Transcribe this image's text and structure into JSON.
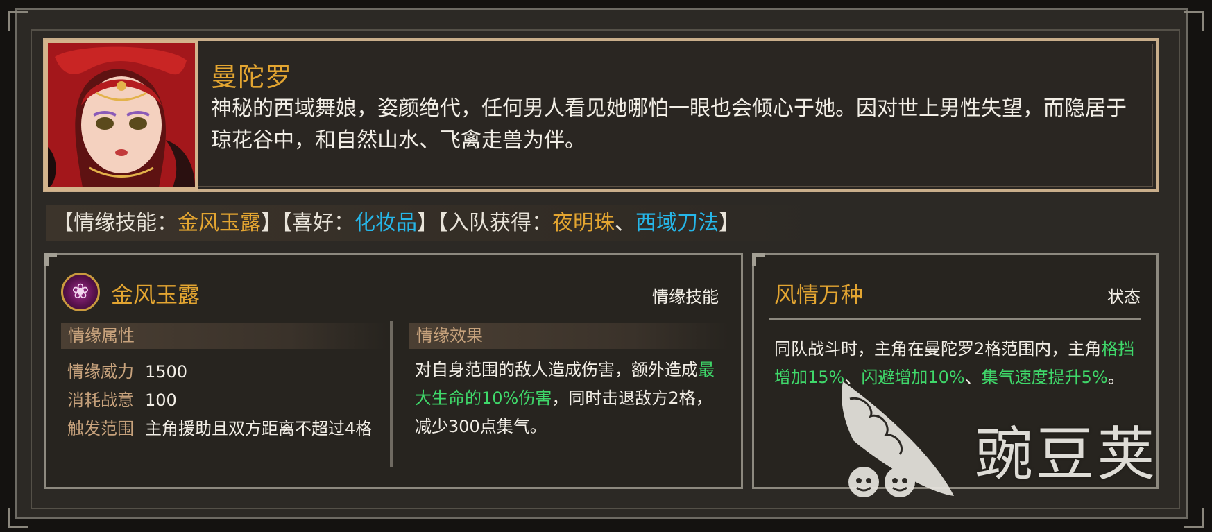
{
  "character": {
    "name": "曼陀罗",
    "description": "神秘的西域舞娘，姿颜绝代，任何男人看见她哪怕一眼也会倾心于她。因对世上男性失望，而隐居于琼花谷中，和自然山水、飞禽走兽为伴。"
  },
  "info_strip": {
    "skill_open": "【情缘技能：",
    "skill_value": "金风玉露",
    "skill_close": "】",
    "hobby_open": "【喜好：",
    "hobby_value": "化妆品",
    "hobby_close": "】",
    "join_open": "【入队获得：",
    "join_item1": "夜明珠",
    "join_sep": "、",
    "join_item2": "西域刀法",
    "join_close": "】"
  },
  "skill_panel": {
    "icon": "lotus-emblem-icon",
    "name": "金风玉露",
    "tag": "情缘技能",
    "attr_header": "情缘属性",
    "attrs": [
      {
        "label": "情缘威力",
        "value": "1500"
      },
      {
        "label": "消耗战意",
        "value": "100"
      },
      {
        "label": "触发范围",
        "value": "主角援助且双方距离不超过4格"
      }
    ],
    "effect_header": "情缘效果",
    "effect_part1": "对自身范围的敌人造成伤害，额外造成",
    "effect_highlight": "最大生命的10%伤害",
    "effect_part2": "，同时击退敌方2格，减少300点集气。"
  },
  "state_panel": {
    "name": "风情万种",
    "tag": "状态",
    "text_part1": "同队战斗时，主角在曼陀罗2格范围内，主角",
    "hl1": "格挡增加15%",
    "sep1": "、",
    "hl2": "闪避增加10%",
    "sep2": "、",
    "hl3": "集气速度提升5%",
    "end": "。"
  },
  "watermark": {
    "text": "豌豆荚",
    "icon": "pea-pod-logo-icon"
  },
  "colors": {
    "gold": "#e3a531",
    "blue": "#26b6e8",
    "green": "#3fd86a",
    "panel_bg": "#27241f",
    "frame_bg": "#2c2925"
  }
}
